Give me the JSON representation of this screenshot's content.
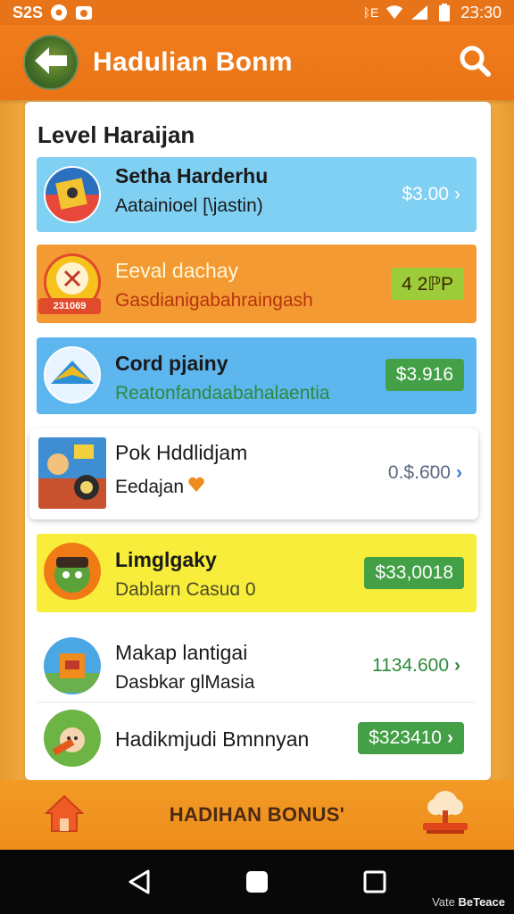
{
  "status_bar": {
    "left_text": "S2S",
    "time": "2Ɜ:30",
    "sim_text": "ᛒE"
  },
  "app_bar": {
    "title": "Hadulian  Bonm"
  },
  "section": {
    "title": "Level Haraijan"
  },
  "rows": [
    {
      "title": "Setha Harderhu",
      "subtitle": "Aatainioel [\\jastin)",
      "price": "$3.00",
      "bg": "#7fd0f3"
    },
    {
      "title": "Eeval dachay",
      "subtitle": "Gasdianigabahraingash",
      "price": "4 2ℙP",
      "bg": "#f39a33",
      "thumb_label": "231069"
    },
    {
      "title": "Cord pjainy",
      "subtitle": "Reatonfandaabahalaentia",
      "price": "$3.916",
      "bg": "#5db6ee"
    },
    {
      "title": "Pok Hddlidjam",
      "subtitle": "Eedajan",
      "price": "0.$.6̈00",
      "bg": "#ffffff"
    },
    {
      "title": "Limglgaky",
      "subtitle": "Dablarn Casuɑ 0",
      "price": "$33,0018",
      "bg": "#f8ed3a"
    },
    {
      "title": "Makap lantigai",
      "subtitle": "Dasbkar ɡlMasia",
      "price": "1134.600",
      "bg": "#ffffff"
    },
    {
      "title": "Hadikmjudi Bmnnyan",
      "subtitle": "",
      "price": "$323410",
      "bg": "#ffffff"
    }
  ],
  "bonus_bar": {
    "label": "HADIHAN BONUS'"
  },
  "watermark": {
    "prefix": "Vate",
    "brand": "BeTeace"
  },
  "colors": {
    "primary_orange": "#ea7416",
    "accent_green": "#4caf50",
    "price_blue": "#5a6a80"
  }
}
